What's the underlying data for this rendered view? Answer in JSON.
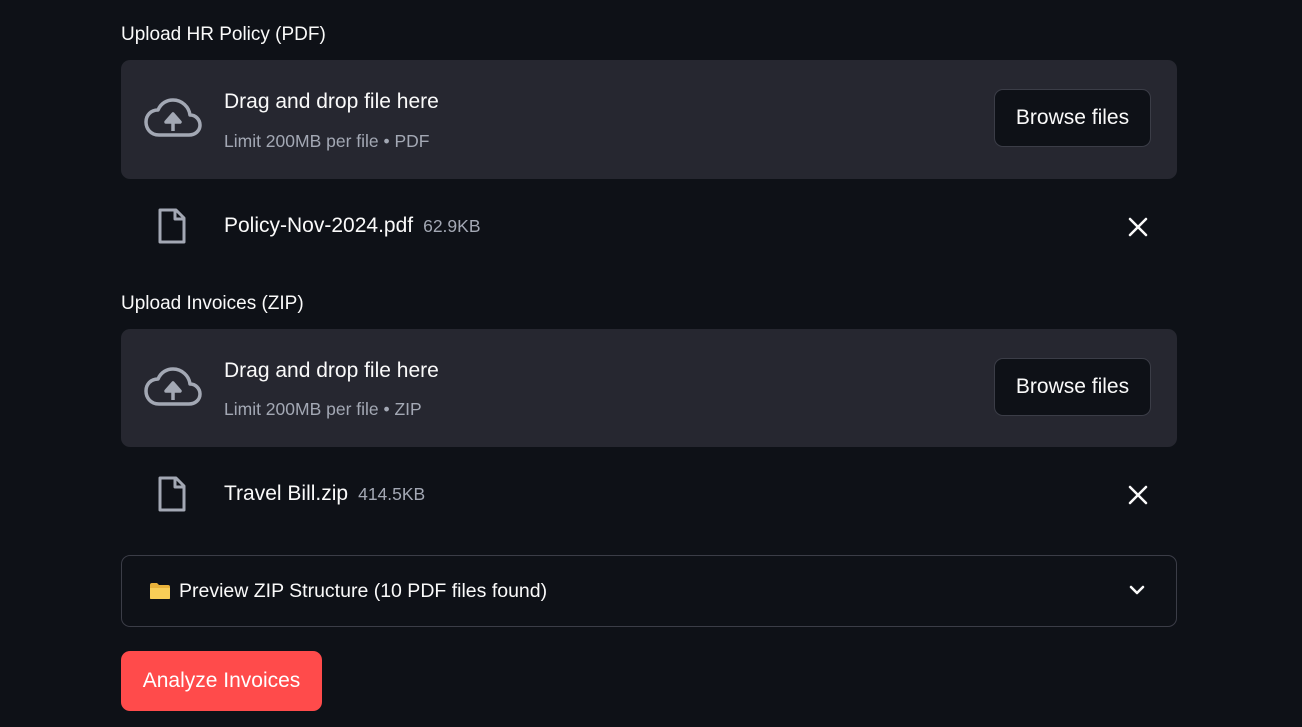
{
  "policy_upload": {
    "label": "Upload HR Policy (PDF)",
    "dropzone_title": "Drag and drop file here",
    "dropzone_hint": "Limit 200MB per file • PDF",
    "browse_label": "Browse files",
    "icon": "cloud-upload-icon",
    "file": {
      "name": "Policy-Nov-2024.pdf",
      "size": "62.9KB",
      "icon": "file-icon"
    }
  },
  "invoice_upload": {
    "label": "Upload Invoices (ZIP)",
    "dropzone_title": "Drag and drop file here",
    "dropzone_hint": "Limit 200MB per file • ZIP",
    "browse_label": "Browse files",
    "icon": "cloud-upload-icon",
    "file": {
      "name": "Travel Bill.zip",
      "size": "414.5KB",
      "icon": "file-icon"
    }
  },
  "preview_expander": {
    "label": "Preview ZIP Structure (10 PDF files found)",
    "icon": "folder-icon",
    "expanded": false
  },
  "analyze_button": {
    "label": "Analyze Invoices"
  },
  "colors": {
    "background": "#0e1117",
    "dropzone": "#262730",
    "primary": "#ff4b4b",
    "muted_text": "#a3a8b4",
    "border": "#3b3d47"
  }
}
